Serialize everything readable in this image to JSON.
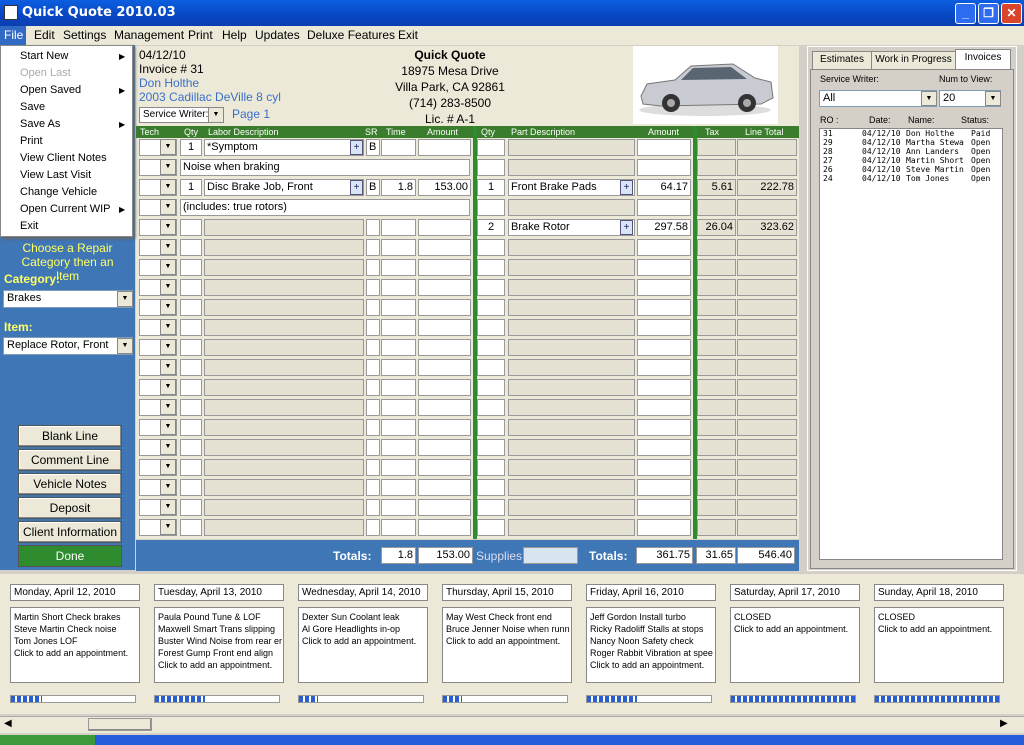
{
  "window": {
    "title": "Quick Quote 2010.03"
  },
  "menu": [
    "File",
    "Edit",
    "Settings",
    "Management",
    "Print",
    "Help",
    "Updates",
    "Deluxe Features",
    "Exit"
  ],
  "file_menu": [
    {
      "label": "Start New",
      "submenu": true,
      "disabled": false
    },
    {
      "label": "Open Last",
      "submenu": false,
      "disabled": true
    },
    {
      "label": "Open Saved",
      "submenu": true,
      "disabled": false
    },
    {
      "label": "Save",
      "submenu": false,
      "disabled": false
    },
    {
      "label": "Save As",
      "submenu": true,
      "disabled": false
    },
    {
      "label": "Print",
      "submenu": false,
      "disabled": false
    },
    {
      "label": "View Client Notes",
      "submenu": false,
      "disabled": false
    },
    {
      "label": "View Last Visit",
      "submenu": false,
      "disabled": false
    },
    {
      "label": "Change Vehicle",
      "submenu": false,
      "disabled": false
    },
    {
      "label": "Open Current WIP",
      "submenu": true,
      "disabled": false
    },
    {
      "label": "Exit",
      "submenu": false,
      "disabled": false
    }
  ],
  "invoice": {
    "date": "04/12/10",
    "number": "Invoice # 31",
    "customer": "Don Holthe",
    "vehicle": "2003 Cadillac DeVille 8 cyl",
    "service_writer_label": "Service Writer:",
    "page": "Page 1",
    "shop_name": "Quick Quote",
    "address1": "18975 Mesa Drive",
    "address2": "Villa Park, CA 92861",
    "phone": "(714) 283-8500",
    "license": "Lic. # A-1"
  },
  "columns": {
    "tech": "Tech",
    "qty": "Qty",
    "labor": "Labor Description",
    "sr": "SR",
    "time": "Time",
    "amount": "Amount",
    "pqty": "Qty",
    "part": "Part Description",
    "pamount": "Amount",
    "tax": "Tax",
    "total": "Line Total"
  },
  "rows": [
    {
      "qty": "1",
      "labor": "*Symptom",
      "plus": true,
      "sr": "B",
      "time": "",
      "amount": "",
      "pqty": "",
      "part": "",
      "pamount": "",
      "tax": "",
      "total": "",
      "type": "line"
    },
    {
      "note": "Noise when braking",
      "type": "note"
    },
    {
      "qty": "1",
      "labor": "Disc Brake Job, Front",
      "plus": true,
      "sr": "B",
      "time": "1.8",
      "amount": "153.00",
      "pqty": "1",
      "part": "Front Brake Pads",
      "pplus": true,
      "pamount": "64.17",
      "tax": "5.61",
      "total": "222.78",
      "type": "line"
    },
    {
      "note": "(includes: true rotors)",
      "type": "note"
    },
    {
      "qty": "",
      "labor": "",
      "sr": "",
      "time": "",
      "amount": "",
      "pqty": "2",
      "part": "Brake Rotor",
      "pplus": true,
      "pamount": "297.58",
      "tax": "26.04",
      "total": "323.62",
      "type": "line"
    }
  ],
  "totals": {
    "label": "Totals:",
    "time": "1.8",
    "amount": "153.00",
    "supplies_label": "Supplies:",
    "supplies": "",
    "label2": "Totals:",
    "parts": "361.75",
    "tax": "31.65",
    "grand": "546.40"
  },
  "left": {
    "instructions": "Choose a Repair Category then an Item",
    "category_label": "Category:",
    "category": "Brakes",
    "item_label": "Item:",
    "item": "Replace Rotor, Front",
    "buttons": [
      "Blank Line",
      "Comment Line",
      "Vehicle Notes",
      "Deposit",
      "Client Information"
    ],
    "done": "Done"
  },
  "right": {
    "tabs": [
      "Estimates",
      "Work in Progress",
      "Invoices"
    ],
    "service_writer_label": "Service Writer:",
    "num_label": "Num to View:",
    "service_writer": "All",
    "num": "20",
    "headers": [
      "RO :",
      "Date:",
      "Name:",
      "Status:"
    ],
    "list": [
      {
        "ro": "31",
        "date": "04/12/10",
        "name": "Don Holthe",
        "status": "Paid"
      },
      {
        "ro": "29",
        "date": "04/12/10",
        "name": "Martha Stewa",
        "status": "Open"
      },
      {
        "ro": "28",
        "date": "04/12/10",
        "name": "Ann Landers",
        "status": "Open"
      },
      {
        "ro": "27",
        "date": "04/12/10",
        "name": "Martin Short",
        "status": "Open"
      },
      {
        "ro": "26",
        "date": "04/12/10",
        "name": "Steve Martin",
        "status": "Open"
      },
      {
        "ro": "24",
        "date": "04/12/10",
        "name": "Tom Jones",
        "status": "Open"
      }
    ]
  },
  "calendar": [
    {
      "day": "Monday, April 12, 2010",
      "appts": [
        "Martin Short Check brakes",
        "Steve Martin Check noise",
        "Tom Jones LOF",
        "Click to add an appointment."
      ],
      "load": 0.25
    },
    {
      "day": "Tuesday, April 13, 2010",
      "appts": [
        "Paula Pound Tune & LOF",
        "Maxwell Smart Trans slipping",
        "Buster Wind Noise from rear er",
        "Forest Gump Front end align",
        "Click to add an appointment."
      ],
      "load": 0.4
    },
    {
      "day": "Wednesday, April 14, 2010",
      "appts": [
        "Dexter Sun Coolant leak",
        "Al Gore Headlights in-op",
        "Click to add an appointment."
      ],
      "load": 0.15
    },
    {
      "day": "Thursday, April 15, 2010",
      "appts": [
        "May West Check front end",
        "Bruce Jenner Noise when runn",
        "Click to add an appointment."
      ],
      "load": 0.15
    },
    {
      "day": "Friday, April 16, 2010",
      "appts": [
        "Jeff Gordon Install turbo",
        "Ricky Radoliff Stalls at stops",
        "Nancy Noon Safety check",
        "Roger Rabbit Vibration at spee",
        "Click to add an appointment."
      ],
      "load": 0.4
    },
    {
      "day": "Saturday, April 17, 2010",
      "appts": [
        "CLOSED",
        "Click to add an appointment."
      ],
      "load": 1.0
    },
    {
      "day": "Sunday, April 18, 2010",
      "appts": [
        "CLOSED",
        "Click to add an appointment."
      ],
      "load": 1.0
    }
  ]
}
